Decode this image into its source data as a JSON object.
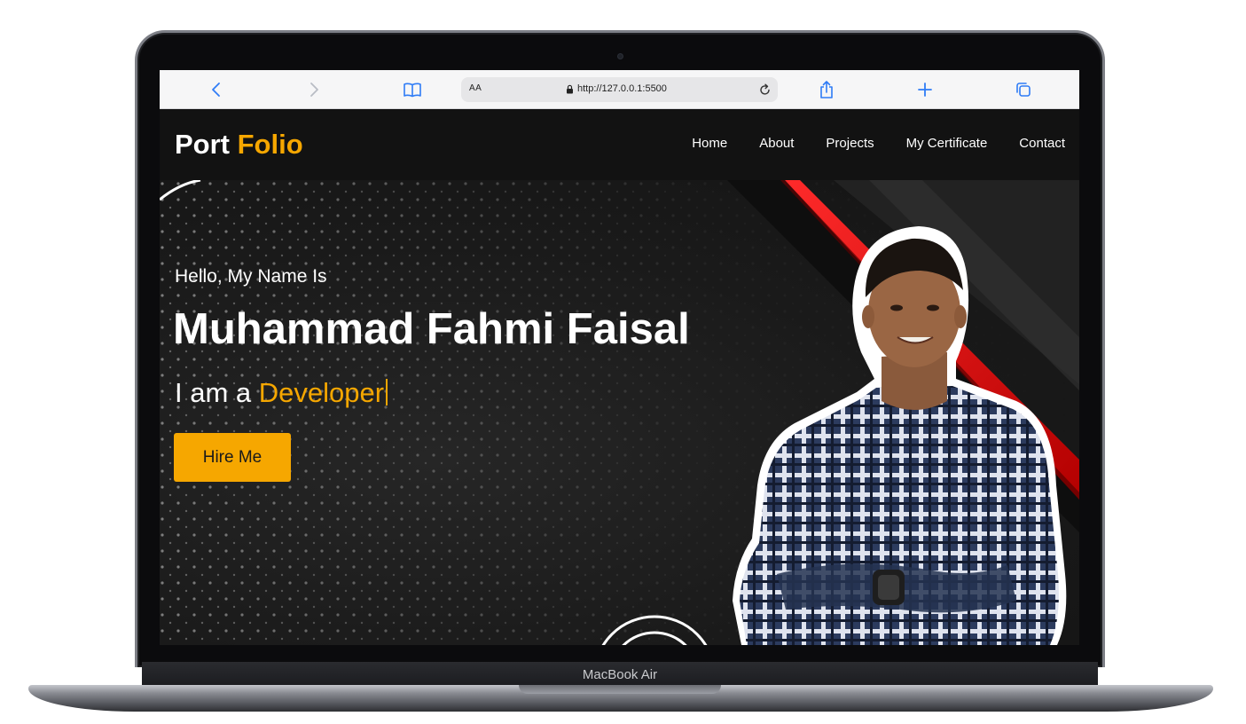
{
  "device": {
    "model_label": "MacBook Air"
  },
  "browser": {
    "text_size_button": "AA",
    "url": "http://127.0.0.1:5500",
    "icons": {
      "back": "chevron-left-icon",
      "forward": "chevron-right-icon",
      "bookmarks": "book-icon",
      "lock": "lock-icon",
      "reload": "reload-icon",
      "share": "share-icon",
      "new_tab": "plus-icon",
      "tabs": "tabs-icon"
    }
  },
  "site": {
    "logo": {
      "first": "Port",
      "second": "Folio"
    },
    "nav": [
      {
        "label": "Home"
      },
      {
        "label": "About"
      },
      {
        "label": "Projects"
      },
      {
        "label": "My Certificate"
      },
      {
        "label": "Contact"
      }
    ],
    "hero": {
      "greeting": "Hello, My Name Is",
      "name": "Muhammad Fahmi Faisal",
      "role_prefix": "I am a",
      "role_highlight": "Developer",
      "cta": "Hire Me"
    },
    "colors": {
      "accent": "#f6a700",
      "nav_bg": "#121212",
      "hero_stripe": "#e01313"
    }
  }
}
